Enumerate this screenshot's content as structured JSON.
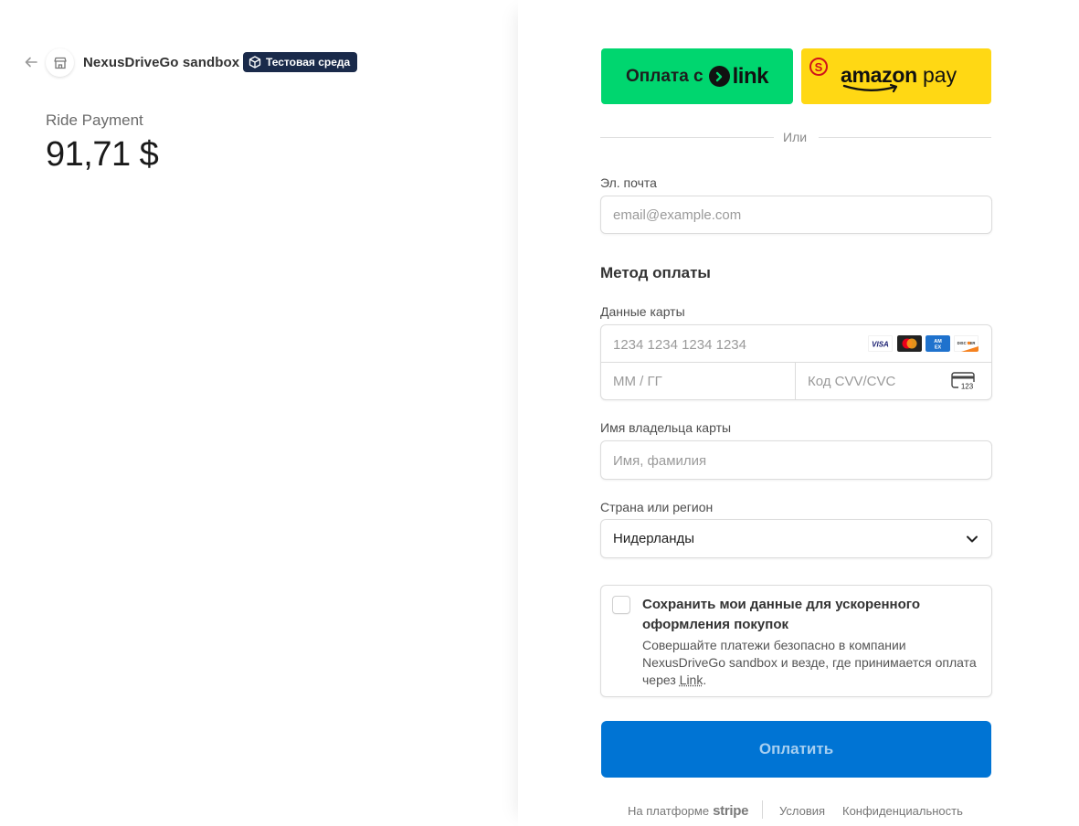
{
  "header": {
    "merchant_name": "NexusDriveGo sandbox",
    "test_badge": "Тестовая среда"
  },
  "summary": {
    "product_name": "Ride Payment",
    "amount": "91,71 $"
  },
  "express": {
    "link_label": "Оплата с",
    "link_word": "link",
    "amazon_word": "amazon",
    "amazon_pay": "pay",
    "amazon_badge": "S"
  },
  "divider": {
    "or": "Или"
  },
  "email": {
    "label": "Эл. почта",
    "placeholder": "email@example.com"
  },
  "payment": {
    "title": "Метод оплаты",
    "card_label": "Данные карты",
    "card_number_placeholder": "1234 1234 1234 1234",
    "expiry_placeholder": "ММ / ГГ",
    "cvc_placeholder": "Код CVV/CVC",
    "cvc_icon_text": "123",
    "brands": [
      "VISA",
      "MASTERCARD",
      "AMEX",
      "DISCOVER"
    ]
  },
  "cardholder": {
    "label": "Имя владельца карты",
    "placeholder": "Имя, фамилия"
  },
  "country": {
    "label": "Страна или регион",
    "value": "Нидерланды"
  },
  "save": {
    "title": "Сохранить мои данные для ускоренного оформления покупок",
    "desc_prefix": "Совершайте платежи безопасно в компании NexusDriveGo sandbox и везде, где принимается оплата через ",
    "desc_link": "Link",
    "desc_suffix": "."
  },
  "submit": {
    "label": "Оплатить"
  },
  "footer": {
    "powered_by": "На платформе",
    "stripe": "stripe",
    "terms": "Условия",
    "privacy": "Конфиденциальность"
  },
  "colors": {
    "link_green": "#00d66f",
    "amazon_yellow": "#ffd814",
    "submit_blue": "#0074d4",
    "badge_navy": "#1a2a4a"
  }
}
